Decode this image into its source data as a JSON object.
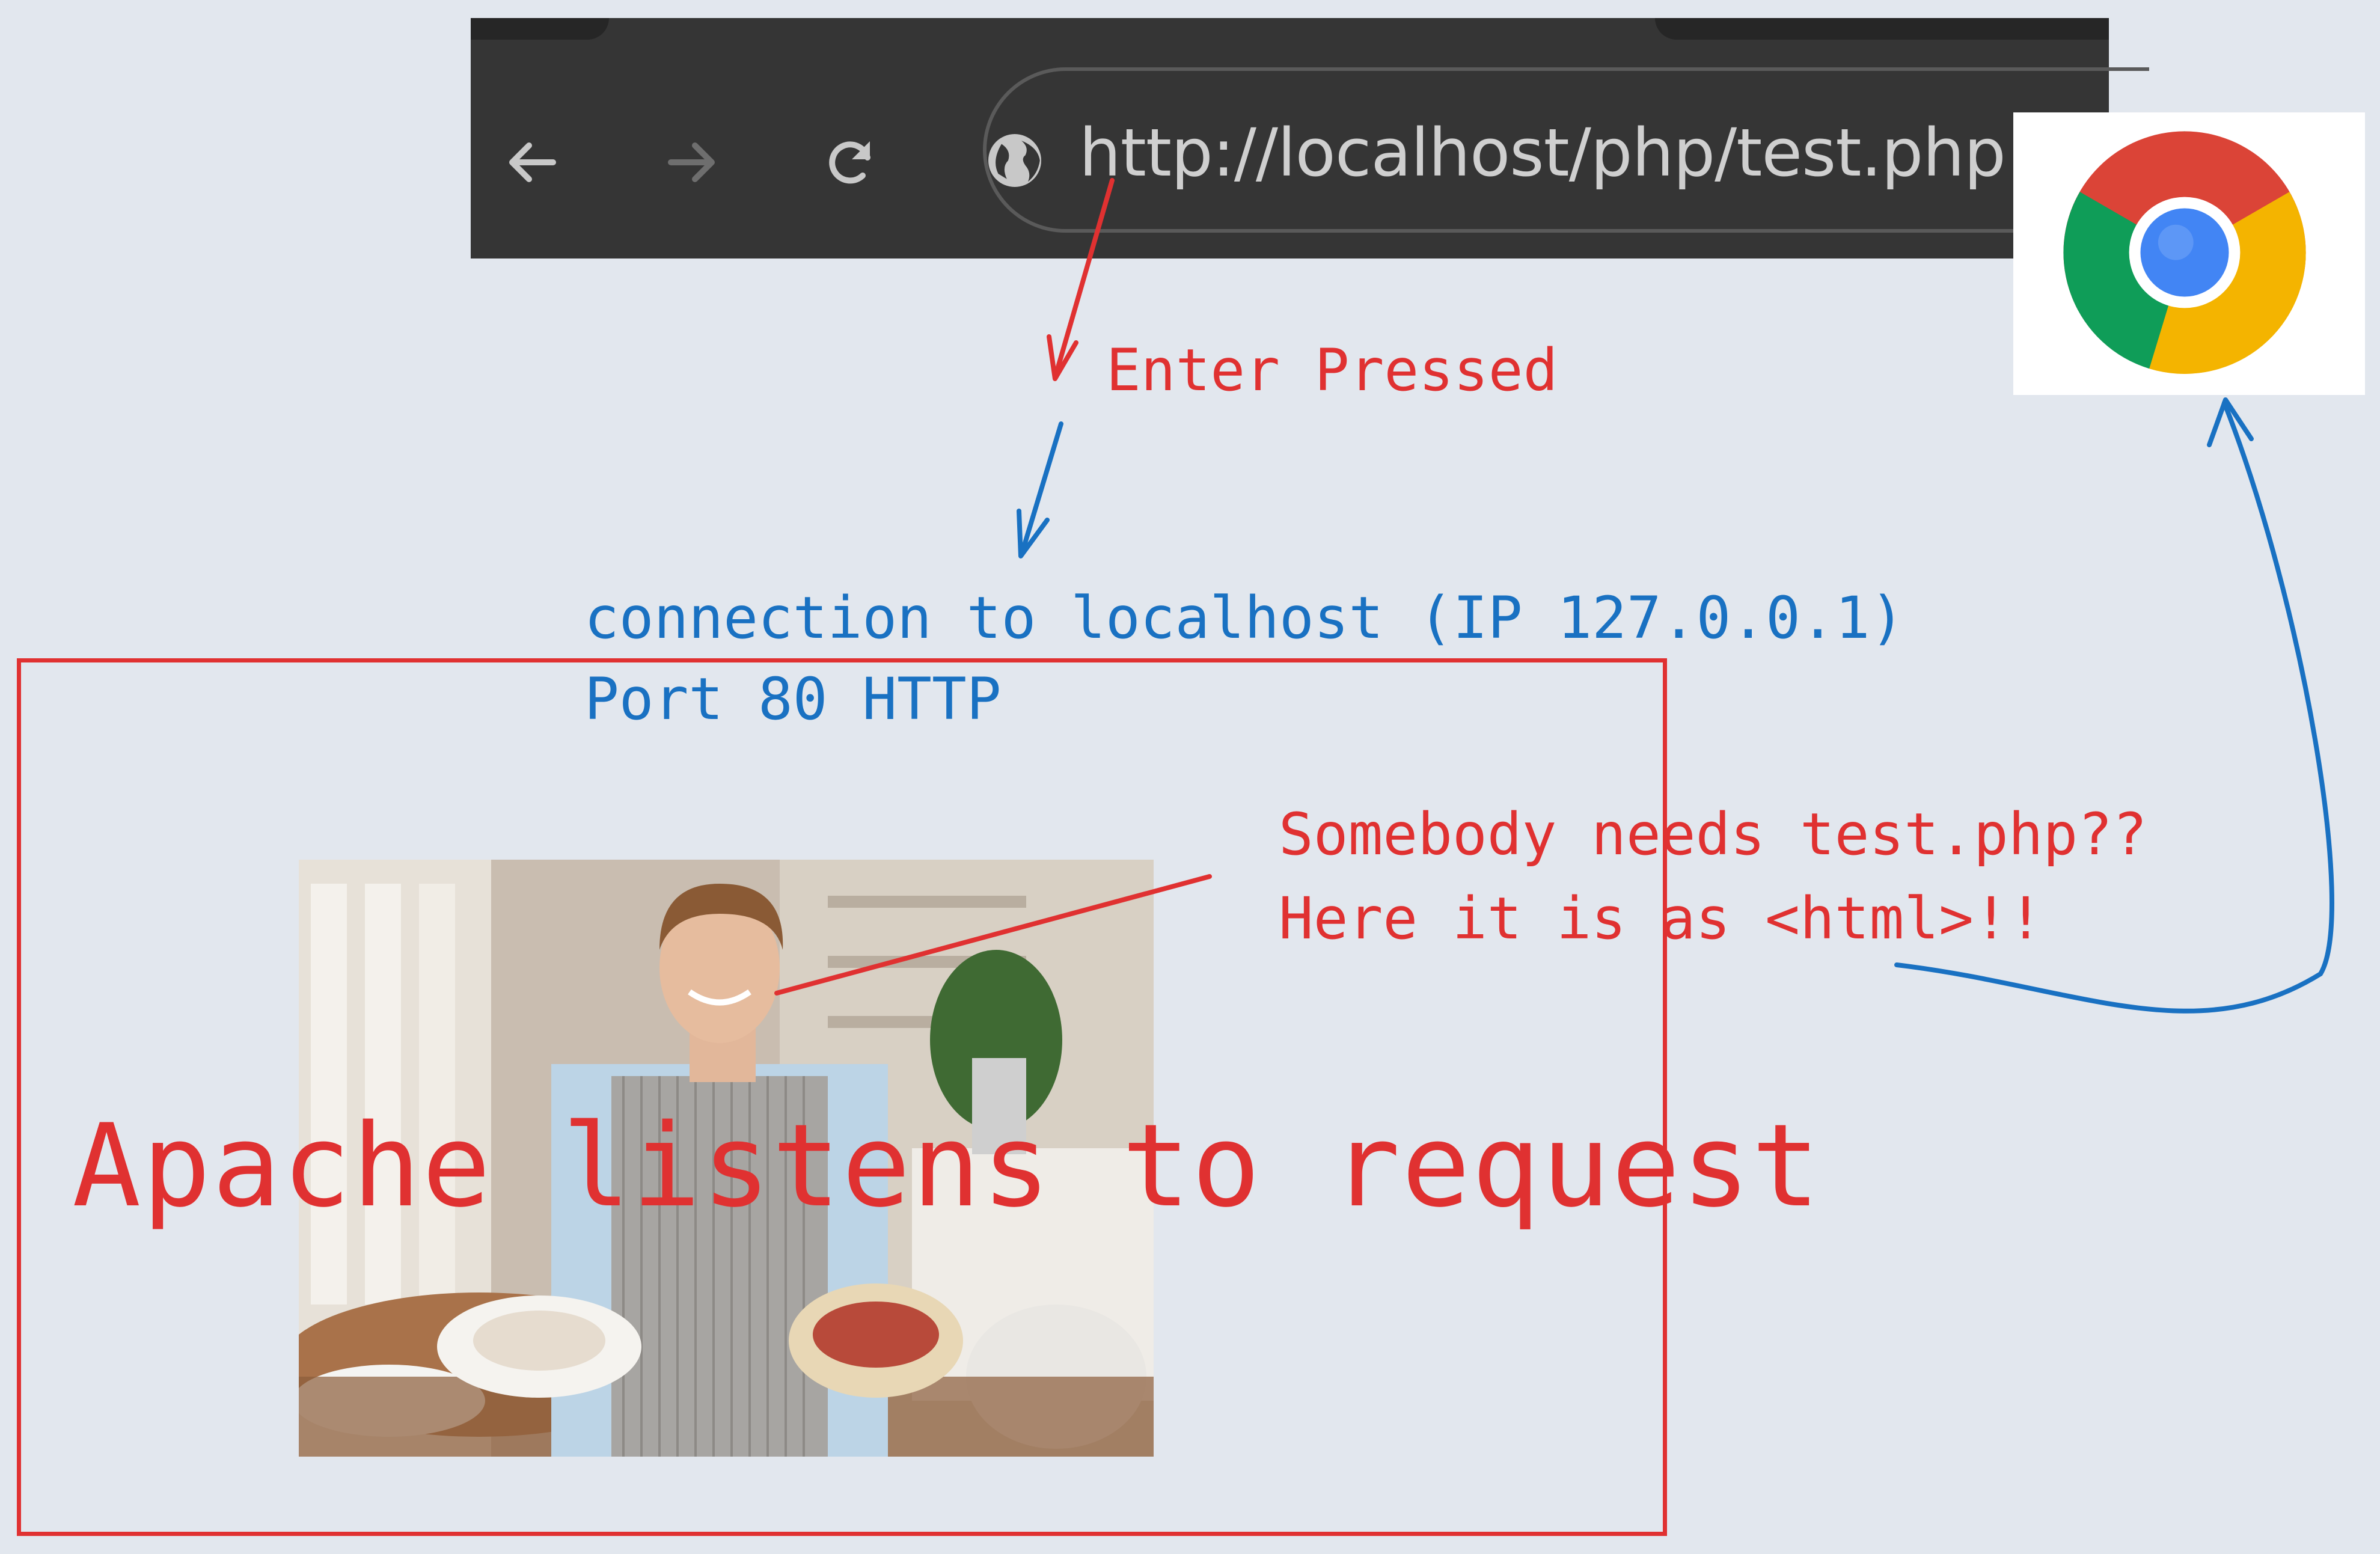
{
  "browser": {
    "url": "http://localhost/php/test.php",
    "icons": {
      "back": "back-arrow-icon",
      "forward": "forward-arrow-icon",
      "reload": "reload-icon",
      "site": "globe-icon",
      "logo": "chrome-logo-icon"
    }
  },
  "annotations": {
    "enter": "Enter Pressed",
    "connection_line1": "connection to localhost (IP 127.0.0.1)",
    "connection_line2": "Port 80 HTTP",
    "response_line1": "Somebody needs test.php??",
    "response_line2": "Here it is as <html>!!",
    "apache": "Apache listens to request"
  },
  "colors": {
    "background": "#e2e7ee",
    "red": "#e03131",
    "blue": "#1971c2",
    "toolbar": "#353535"
  }
}
